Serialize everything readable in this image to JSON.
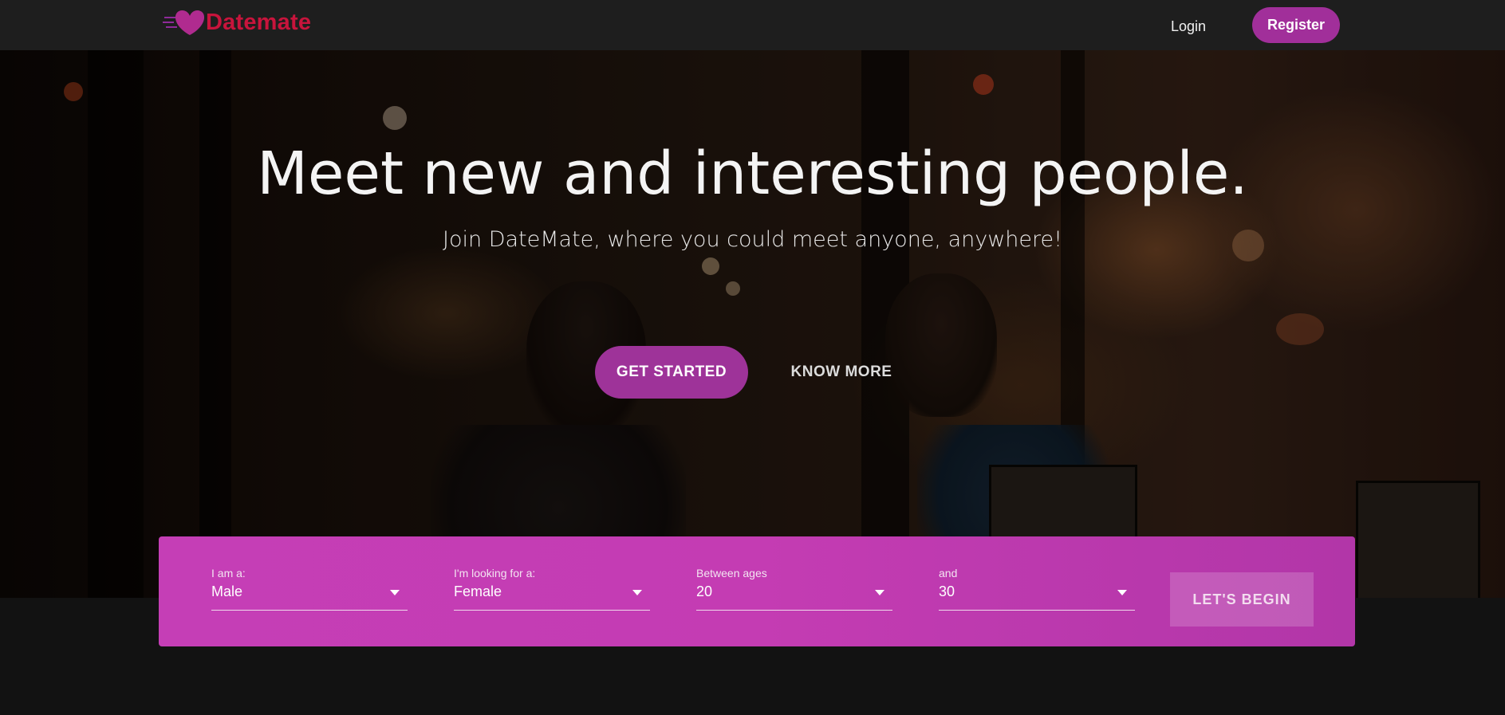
{
  "brand": {
    "name": "Datemate",
    "color": "#c8143c",
    "accent": "#a12f9a"
  },
  "nav": {
    "login_label": "Login",
    "register_label": "Register"
  },
  "hero": {
    "title": "Meet new and interesting people.",
    "subtitle": "Join DateMate, where you could meet anyone, anywhere!",
    "get_started_label": "GET STARTED",
    "know_more_label": "KNOW MORE"
  },
  "search": {
    "iam": {
      "label": "I am a:",
      "value": "Male"
    },
    "looking_for": {
      "label": "I'm looking for a:",
      "value": "Female"
    },
    "age_min": {
      "label": "Between ages",
      "value": "20"
    },
    "age_max": {
      "label": "and",
      "value": "30"
    },
    "submit_label": "LET'S BEGIN",
    "panel_color": "#c43cb3"
  },
  "icons": {
    "logo": "heart-icon",
    "dropdown": "chevron-down-icon"
  }
}
